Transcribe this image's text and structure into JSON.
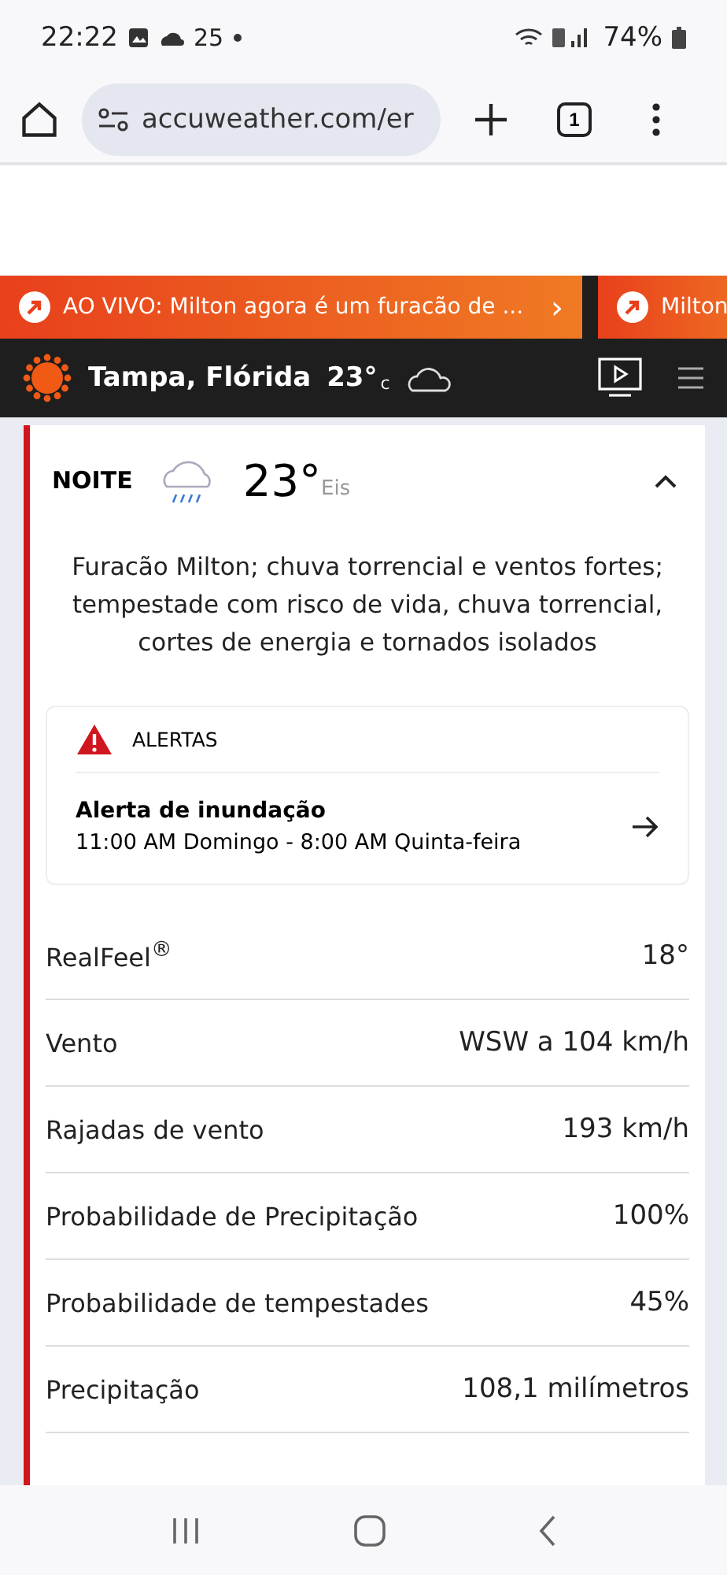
{
  "status_bar": {
    "time": "22:22",
    "temperature": "25",
    "battery": "74%"
  },
  "browser": {
    "url": "accuweather.com/er",
    "tab_count": "1"
  },
  "ticker": [
    {
      "text": "AO VIVO: Milton agora é um furacão de ...",
      "chevron": "›"
    },
    {
      "text": "Milton"
    }
  ],
  "header": {
    "location": "Tampa, Flórida",
    "temperature": "23°",
    "unit": "c"
  },
  "period": {
    "label": "NOITE",
    "temperature": "23°",
    "unit": "Eis",
    "expanded": true,
    "description": "Furacão Milton; chuva torrencial e ventos fortes; tempestade com risco de vida, chuva torrencial, cortes de energia e tornados isolados"
  },
  "alerts": {
    "title": "ALERTAS",
    "items": [
      {
        "name": "Alerta de inundação",
        "period": "11:00 AM Domingo - 8:00 AM Quinta-feira"
      }
    ]
  },
  "details": [
    {
      "label": "RealFeel$^{®}$",
      "value": "18°"
    },
    {
      "label": "Vento",
      "value": "WSW a 104 km/h"
    },
    {
      "label": "Rajadas de vento",
      "value": "193 km/h"
    },
    {
      "label": "Probabilidade de Precipitação",
      "value": "100%"
    },
    {
      "label": "Probabilidade de tempestades",
      "value": "45%"
    },
    {
      "label": "Precipitação",
      "value": "108,1 milímetros"
    }
  ]
}
